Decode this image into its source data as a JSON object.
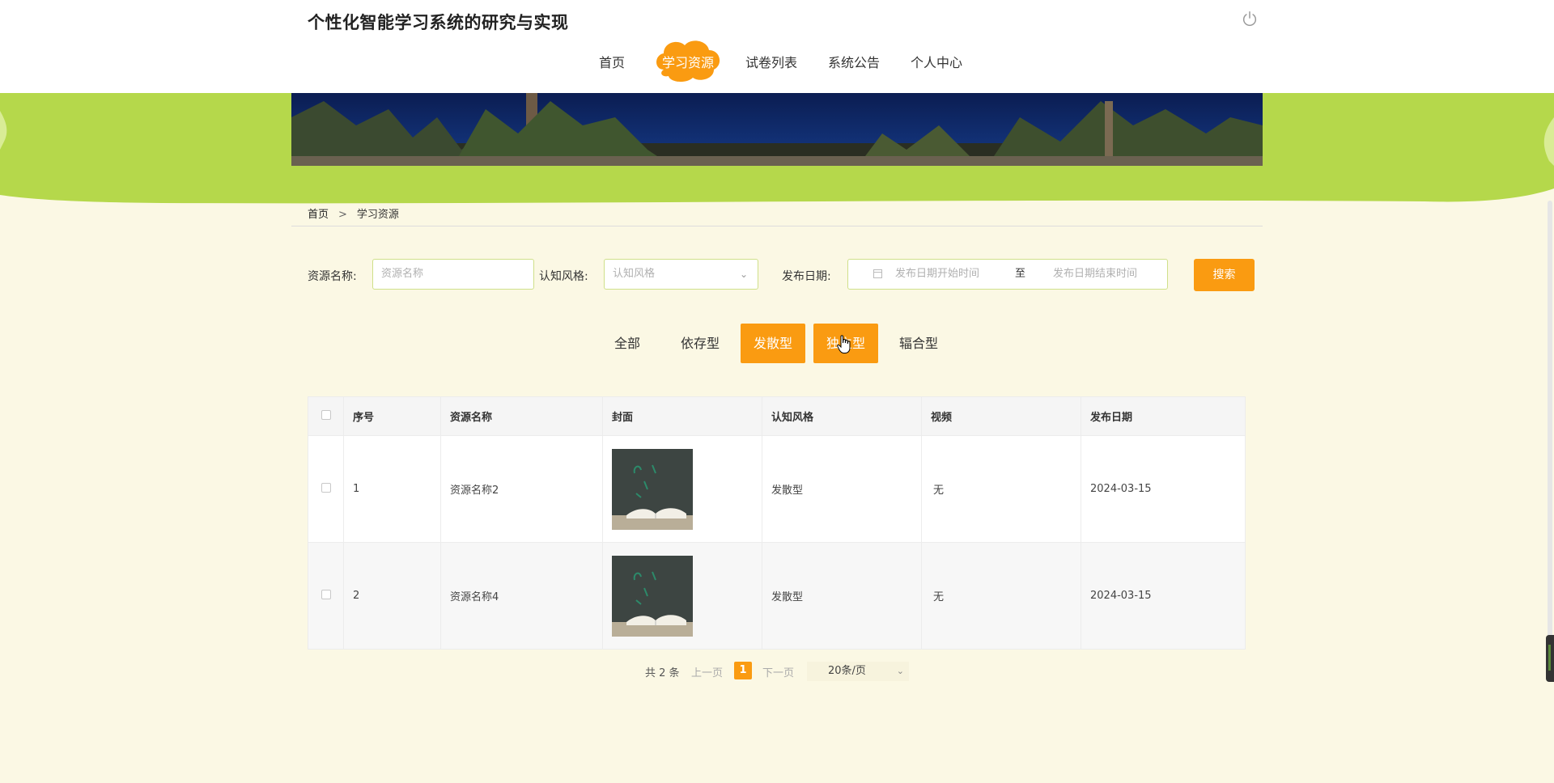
{
  "header": {
    "title": "个性化智能学习系统的研究与实现",
    "nav": [
      "首页",
      "学习资源",
      "试卷列表",
      "系统公告",
      "个人中心"
    ],
    "active_nav": "学习资源"
  },
  "breadcrumb": {
    "home": "首页",
    "sep": ">",
    "current": "学习资源"
  },
  "filters": {
    "name_label": "资源名称:",
    "name_placeholder": "资源名称",
    "style_label": "认知风格:",
    "style_placeholder": "认知风格",
    "date_label": "发布日期:",
    "date_start_placeholder": "发布日期开始时间",
    "date_to": "至",
    "date_end_placeholder": "发布日期结束时间",
    "search_button": "搜索"
  },
  "tabs": [
    "全部",
    "依存型",
    "发散型",
    "独立型",
    "辐合型"
  ],
  "active_tabs": [
    "发散型",
    "独立型"
  ],
  "table": {
    "columns": [
      "序号",
      "资源名称",
      "封面",
      "认知风格",
      "视频",
      "发布日期"
    ],
    "rows": [
      {
        "no": "1",
        "name": "资源名称2",
        "style": "发散型",
        "video": "无",
        "date": "2024-03-15"
      },
      {
        "no": "2",
        "name": "资源名称4",
        "style": "发散型",
        "video": "无",
        "date": "2024-03-15"
      }
    ]
  },
  "pager": {
    "total": "共 2 条",
    "prev": "上一页",
    "page": "1",
    "next": "下一页",
    "page_size": "20条/页"
  },
  "colors": {
    "accent": "#fa9b11",
    "band": "#b5d84b",
    "page_bg": "#fbf8e4"
  },
  "icons": [
    "power-icon",
    "calendar-icon",
    "chevron-down-icon",
    "hand-cursor-icon"
  ]
}
